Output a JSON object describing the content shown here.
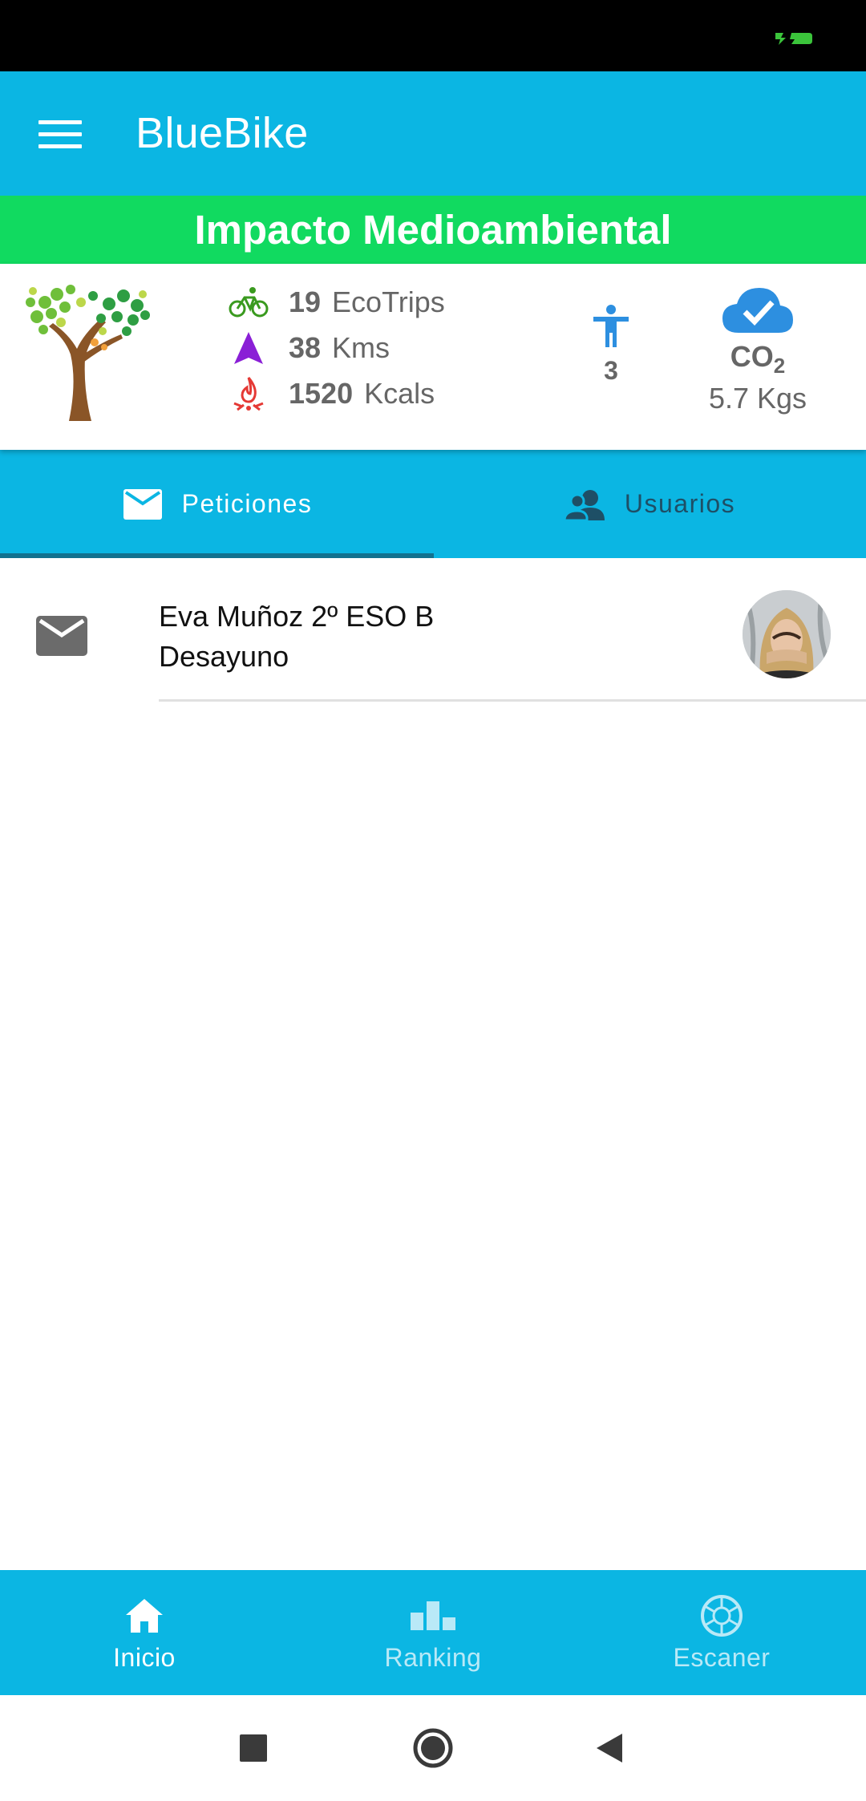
{
  "app": {
    "title": "BlueBike"
  },
  "banner": {
    "title": "Impacto Medioambiental"
  },
  "stats": {
    "trips": {
      "value": "19",
      "unit": "EcoTrips"
    },
    "distance": {
      "value": "38",
      "unit": "Kms"
    },
    "calories": {
      "value": "1520",
      "unit": "Kcals"
    },
    "people": "3",
    "co2": {
      "label": "CO",
      "sub": "2",
      "value": "5.7 Kgs"
    }
  },
  "tabs": [
    {
      "label": "Peticiones",
      "icon": "mail-icon",
      "active": true
    },
    {
      "label": "Usuarios",
      "icon": "users-icon",
      "active": false
    }
  ],
  "requests": [
    {
      "title": "Eva Muñoz 2º ESO B",
      "subtitle": "Desayuno"
    }
  ],
  "bottom_nav": [
    {
      "label": "Inicio",
      "icon": "home-icon",
      "active": true
    },
    {
      "label": "Ranking",
      "icon": "ranking-icon",
      "active": false
    },
    {
      "label": "Escaner",
      "icon": "camera-shutter-icon",
      "active": false
    }
  ],
  "colors": {
    "primary": "#0bb6e3",
    "banner": "#11da60",
    "tab_indicator": "#12728f",
    "bike_icon": "#3a9a1f",
    "nav_arrow_icon": "#8a1fd6",
    "fire_icon": "#e53935",
    "person_icon": "#2d8fe0",
    "cloud_icon": "#2d8fe0"
  }
}
